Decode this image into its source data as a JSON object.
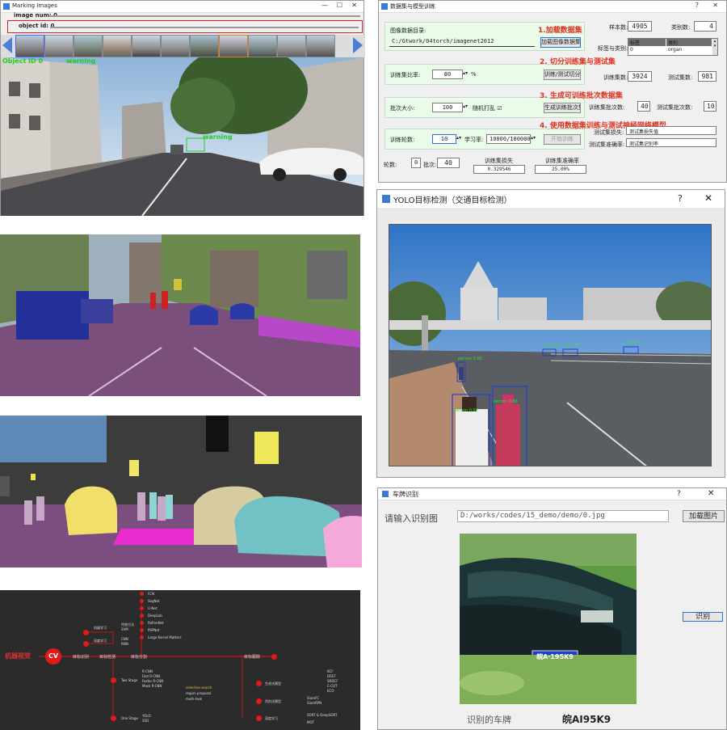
{
  "marking": {
    "title": "Marking Images",
    "image_num_label": "image num: 0",
    "object_id_label": "object id: 0",
    "overlay_label": "Object ID  0",
    "overlay_class": "warning",
    "car_label": "warning"
  },
  "training": {
    "title": "数据集与模型训练",
    "help": "?",
    "close": "✕",
    "dir_label": "图像数据目录:",
    "dir_value": "C:/Gtwork/04torch/imagenet2012",
    "load_btn": "加载图像数据集",
    "step1": "1.加载数据集",
    "step2": "2. 切分训练集与测试集",
    "step3": "3. 生成可训练批次数据集",
    "step4": "4. 使用数据集训练与测试神经网络模型",
    "ratio_label": "训练集比率:",
    "ratio_value": "80",
    "ratio_unit": "%",
    "split_btn": "训练/测试切分",
    "batch_label": "批次大小:",
    "batch_value": "100",
    "shuffle_label": "随机打乱 ☑",
    "gen_btn": "生成训练批次集",
    "epoch_label": "训练轮数:",
    "epoch_value": "10",
    "lr_label": "学习率:",
    "lr_value": "10000/1000000",
    "start_btn": "开始训练",
    "samples_label": "样本数:",
    "samples_value": "4905",
    "classes_label": "类别数:",
    "classes_value": "4",
    "label_map_label": "标签与类别:",
    "table_headers": [
      "标签",
      "类别"
    ],
    "table_row": [
      "0",
      "organ"
    ],
    "train_count_label": "训练集数:",
    "train_count_value": "3924",
    "test_count_label": "测试集数:",
    "test_count_value": "981",
    "train_batches_label": "训练集批次数:",
    "train_batches_value": "40",
    "test_batches_label": "测试集批次数:",
    "test_batches_value": "10",
    "test_loss_label": "测试集损失:",
    "test_loss_value": "测试集损失值",
    "test_acc_label": "测试集准确率:",
    "test_acc_value": "测试集识别率",
    "round_label": "轮数:",
    "round_value": "0",
    "batch2_label": "批次:",
    "batch2_value": "40",
    "train_loss_label": "训练集损失",
    "train_loss_value": "0.329546",
    "train_acc_label": "训练集准确率",
    "train_acc_value": "25.00%"
  },
  "yolo": {
    "title": "YOLO目标检测（交通目标检测）",
    "help": "?",
    "close": "✕",
    "det_labels": [
      "person 0.92",
      "person 0.88",
      "car 0.81",
      "car 0.77",
      "car 0.70",
      "person 0.65"
    ]
  },
  "plate": {
    "title": "车牌识别",
    "help": "?",
    "close": "✕",
    "input_label": "请输入识别图",
    "path_value": "D:/works/codes/15_demo/demo/0.jpg",
    "load_btn": "加载图片",
    "recognize_btn": "识别",
    "plate_text": "皖A·195K9",
    "result_label": "识别的车牌",
    "result_value": "皖AI95K9"
  },
  "mindmap": {
    "root": "机器视觉",
    "cv": "CV",
    "branch_main": [
      "目标识别",
      "目标检测",
      "目标分割",
      "目标跟踪"
    ],
    "rec_items": [
      "机器学习",
      "深度学习"
    ],
    "rec_sub": [
      "传统方法",
      "SVM",
      "CNN",
      "RNN"
    ],
    "seg_items": [
      "FCN",
      "SegNet",
      "U-Net",
      "DeepLab",
      "RefineNet",
      "PSPNet",
      "Large Kernel Matters"
    ],
    "det_two": "Two Stage",
    "det_two_items": [
      "R-CNN",
      "Fast R-CNN",
      "Faster R-CNN",
      "Mask R-CNN"
    ],
    "det_one": "One Stage",
    "det_one_items": [
      "YOLO",
      "SSD"
    ],
    "det_notes": [
      "selective search",
      "region proposal",
      "multi-task"
    ],
    "trk_items": [
      "生成式模型",
      "判别式模型",
      "深度学习"
    ],
    "trk_sub": [
      "KCF",
      "DSST",
      "SRDCF",
      "C-COT",
      "ECO",
      "SiamFC",
      "SiamRPN",
      "SORT & DeepSORT",
      "MOT"
    ]
  },
  "colors": {
    "accent_red": "#e03020",
    "pane_green": "#eafbe9",
    "mindmap_bg": "#2b2b2b",
    "seg_purple": "#7b4f7b"
  }
}
